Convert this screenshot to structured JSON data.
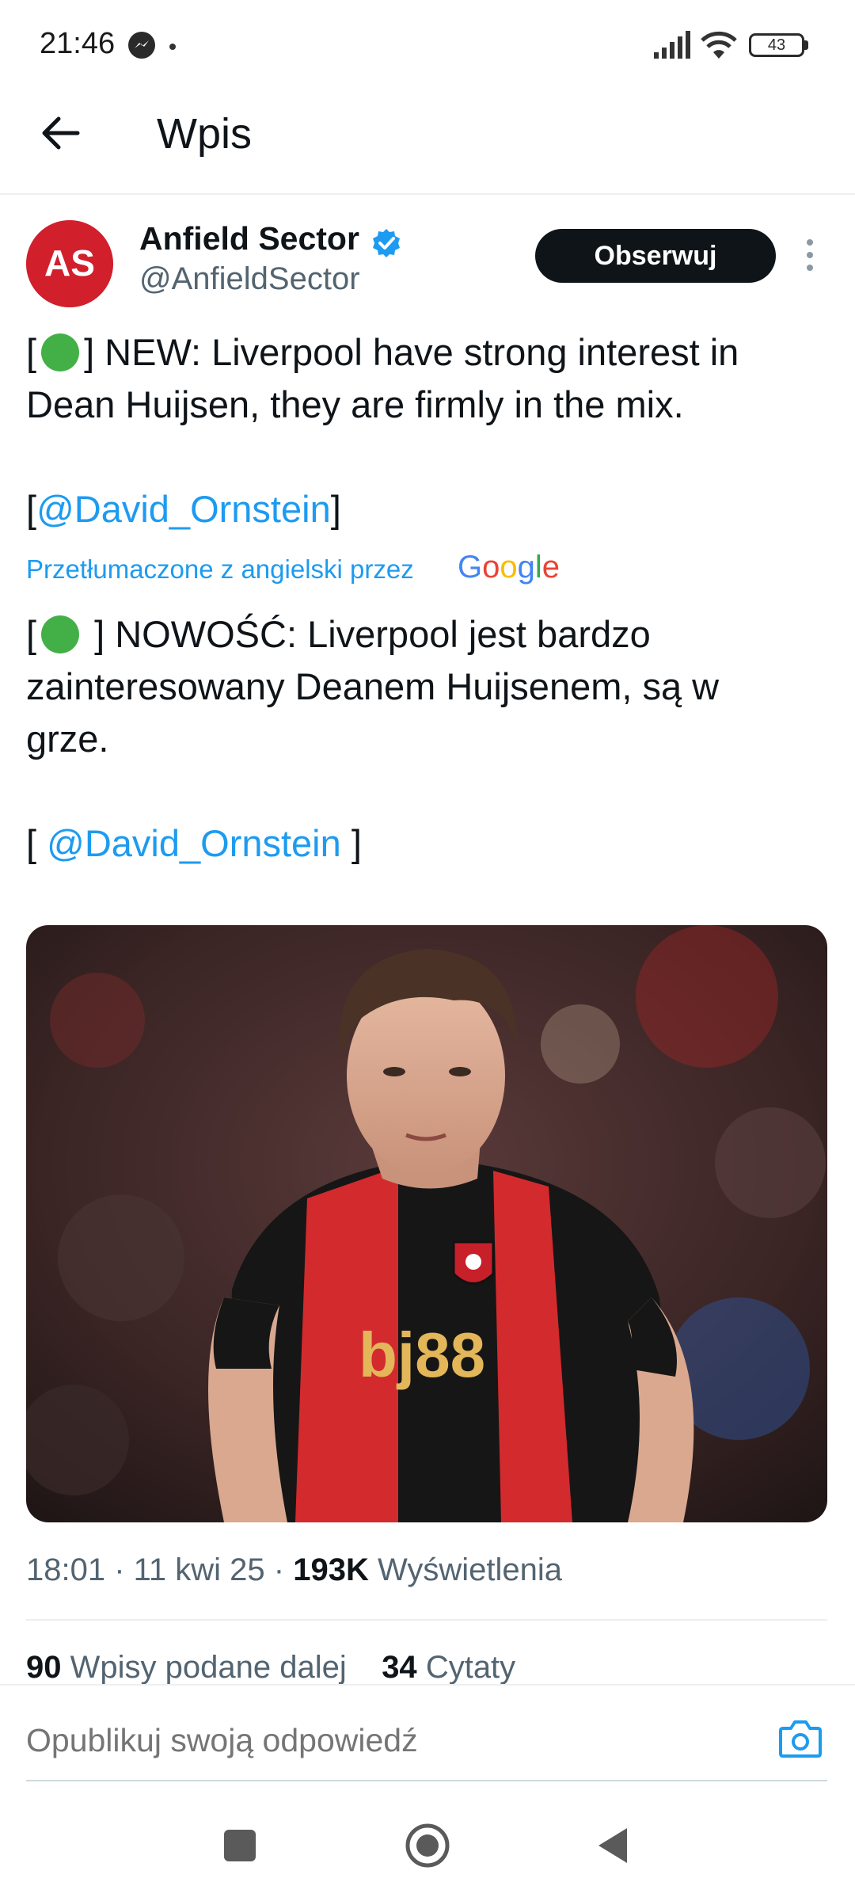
{
  "status_bar": {
    "time": "21:46",
    "battery": "43"
  },
  "header": {
    "title": "Wpis"
  },
  "author": {
    "name": "Anfield Sector",
    "handle": "@AnfieldSector",
    "avatar_text": "AS",
    "follow_label": "Obserwuj"
  },
  "tweet": {
    "line1": "] NEW: Liverpool have strong interest in",
    "line2": "Dean Huijsen, they are firmly in the mix.",
    "mention": "@David_Ornstein",
    "translated_label": "Przetłumaczone z angielski przez",
    "google": "Google",
    "translation_line1": " ] NOWOŚĆ: Liverpool jest bardzo",
    "translation_line2": "zainteresowany Deanem Huijsenem, są w",
    "translation_line3": "grze.",
    "translation_mention": "@David_Ornstein"
  },
  "meta": {
    "time": "18:01",
    "date": "11 kwi 25",
    "views_count": "193K",
    "views_label": "Wyświetlenia"
  },
  "stats": {
    "reposts_count": "90",
    "reposts_label": "Wpisy podane dalej",
    "quotes_count": "34",
    "quotes_label": "Cytaty"
  },
  "reply": {
    "placeholder": "Opublikuj swoją odpowiedź"
  },
  "colors": {
    "accent": "#1d9bf0",
    "text": "#0f1419",
    "muted": "#536471",
    "follow_bg": "#0f1419"
  }
}
